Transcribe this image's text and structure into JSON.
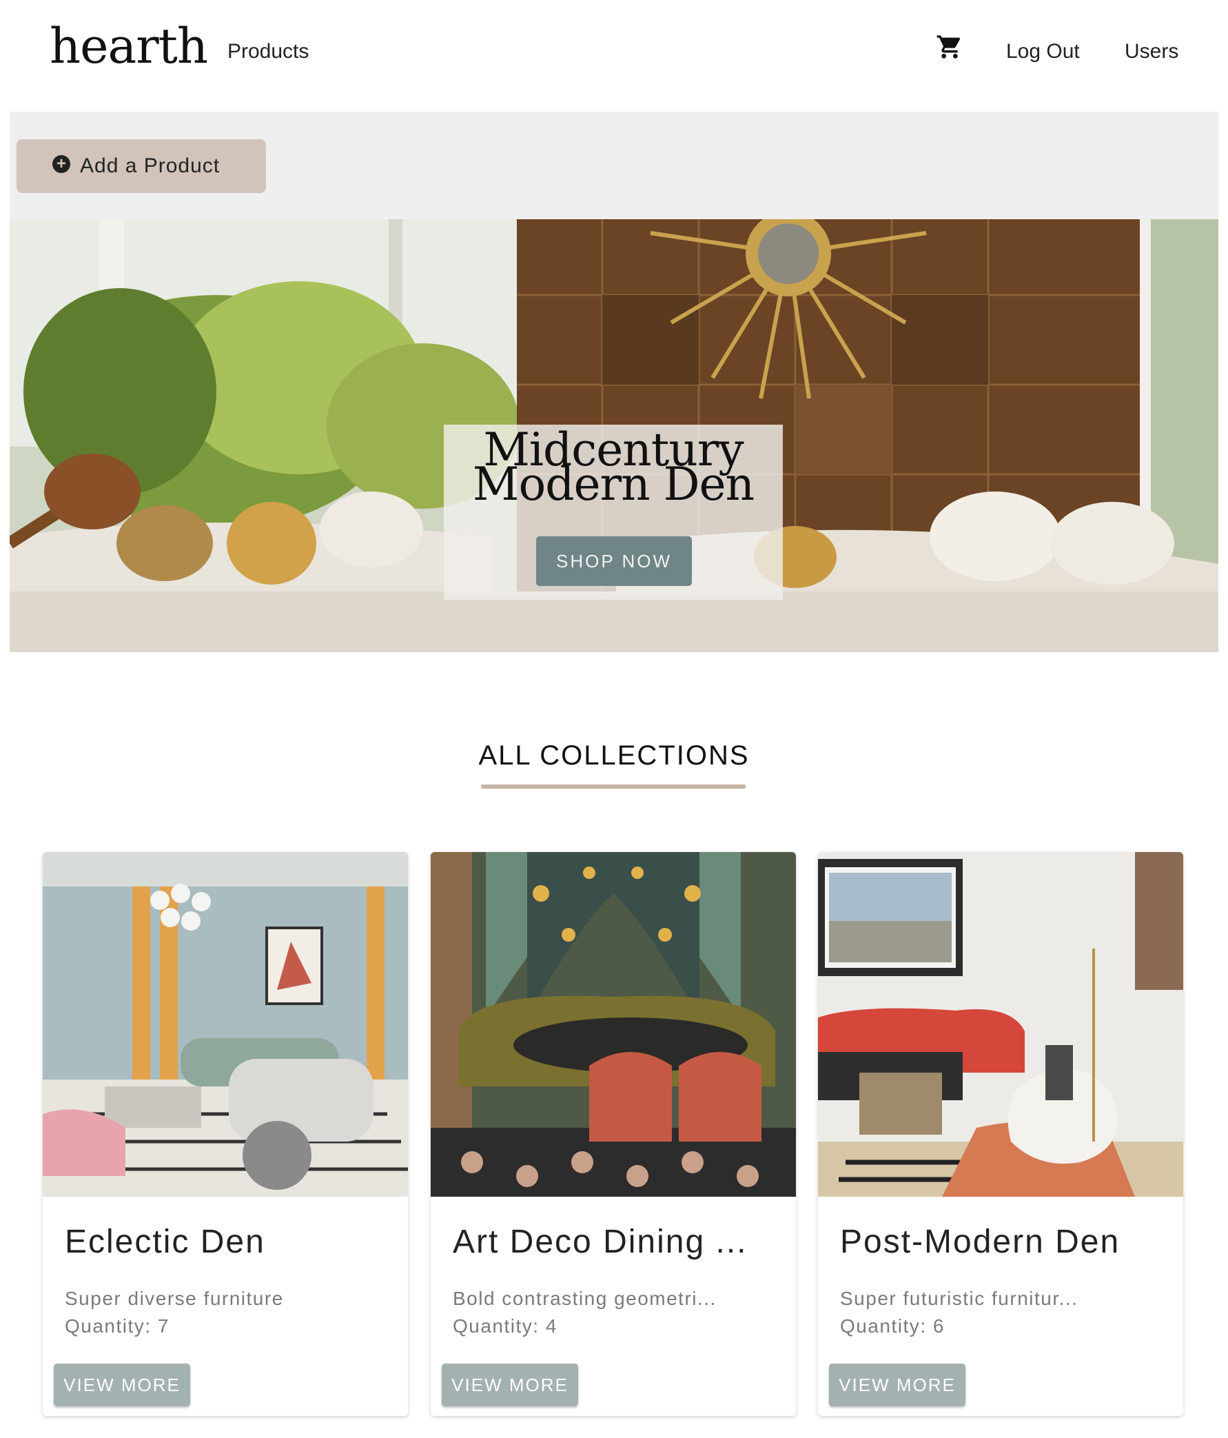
{
  "header": {
    "logo": "hearth",
    "nav_products": "Products",
    "cart_icon": "shopping-cart-icon",
    "nav_logout": "Log Out",
    "nav_users": "Users"
  },
  "toolbar": {
    "add_icon": "add-circle-icon",
    "add_label": "Add a Product"
  },
  "hero": {
    "title_line1": "Midcentury",
    "title_line2": "Modern Den",
    "button": "SHOP NOW"
  },
  "collections": {
    "heading": "ALL COLLECTIONS",
    "cards": [
      {
        "title": "Eclectic Den",
        "description": "Super diverse furniture",
        "quantity": "Quantity: 7",
        "button": "VIEW MORE"
      },
      {
        "title": "Art Deco Dining ...",
        "description": "Bold contrasting geometri...",
        "quantity": "Quantity: 4",
        "button": "VIEW MORE"
      },
      {
        "title": "Post-Modern Den",
        "description": "Super futuristic furnitur...",
        "quantity": "Quantity: 6",
        "button": "VIEW MORE"
      }
    ]
  },
  "colors": {
    "add_button_bg": "#d2c4ba",
    "shop_button_bg": "#6f8587",
    "view_more_bg": "#a3b1b0",
    "underline": "#c8b4a4",
    "toolbar_bg": "#efefef"
  }
}
